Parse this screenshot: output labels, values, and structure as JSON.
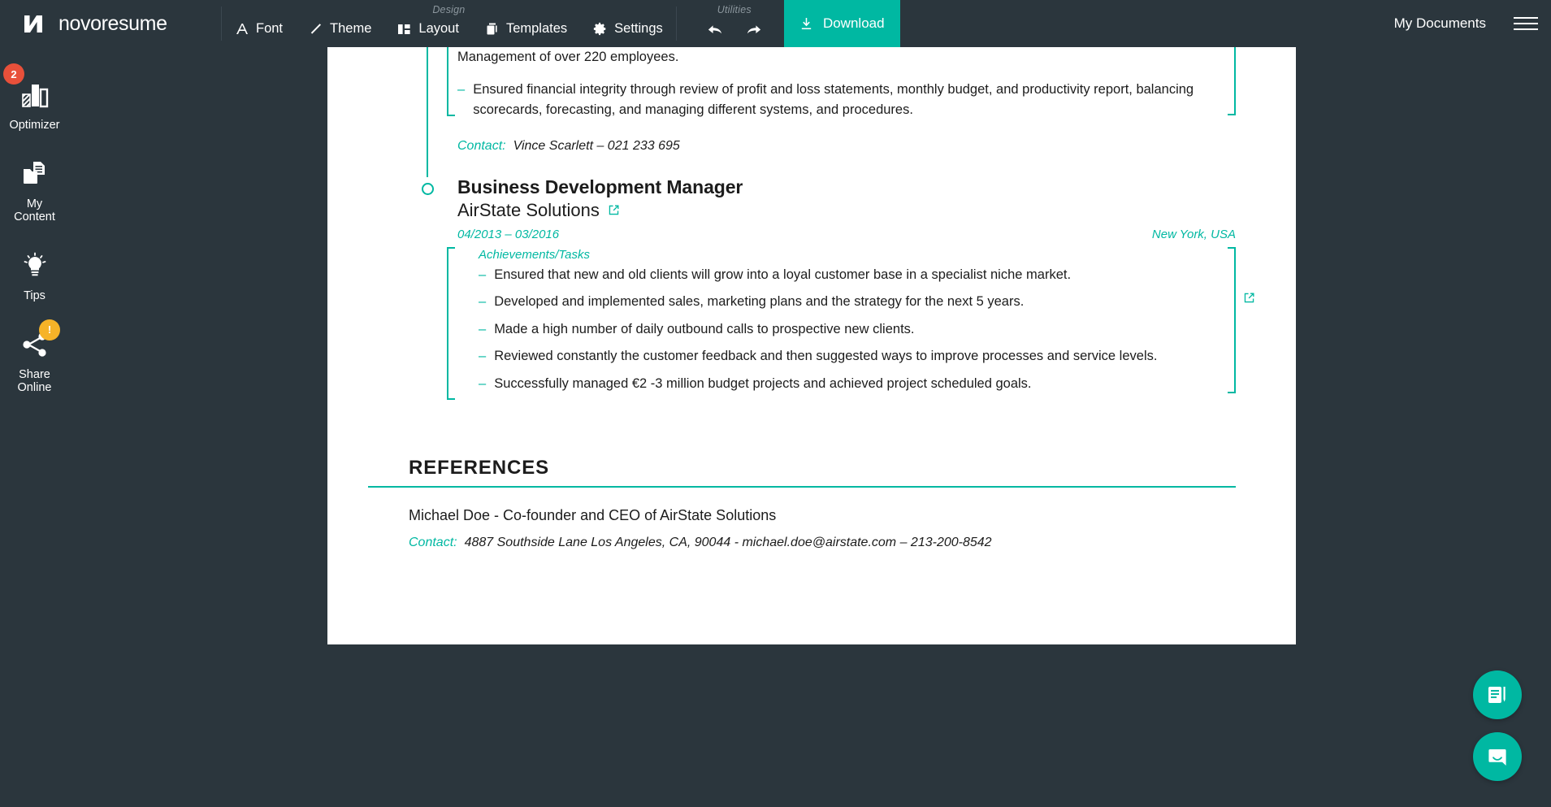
{
  "app": {
    "brand_name": "novoresume",
    "brand_icon": "novoresume-n-logo"
  },
  "toolbar": {
    "design_group_label": "Design",
    "utilities_group_label": "Utilities",
    "items": [
      {
        "label": "Font",
        "icon": "font-a-icon"
      },
      {
        "label": "Theme",
        "icon": "brush-slash-icon"
      },
      {
        "label": "Layout",
        "icon": "layout-columns-icon"
      },
      {
        "label": "Templates",
        "icon": "copy-pages-icon"
      },
      {
        "label": "Settings",
        "icon": "gear-icon"
      }
    ],
    "undo_icon": "undo-arrow-icon",
    "redo_icon": "redo-arrow-icon",
    "download_label": "Download",
    "download_icon": "download-icon",
    "my_documents_label": "My Documents",
    "menu_icon": "hamburger-menu-icon"
  },
  "sidebar": {
    "items": [
      {
        "label": "Optimizer",
        "icon": "bar-chart-icon",
        "badge": "2",
        "badge_color": "#e8503a"
      },
      {
        "label": "My\nContent",
        "label_line1": "My",
        "label_line2": "Content",
        "icon": "folder-document-icon",
        "badge": null
      },
      {
        "label": "Tips",
        "icon": "lightbulb-icon",
        "badge": null
      },
      {
        "label": "Share\nOnline",
        "label_line1": "Share",
        "label_line2": "Online",
        "icon": "share-nodes-icon",
        "badge": "!",
        "badge_color": "#f6b328"
      }
    ]
  },
  "resume": {
    "entry_previous": {
      "partial_bullet_top": "Management of over 220 employees.",
      "bullet_two": "Ensured financial integrity through review of profit and loss statements, monthly budget, and productivity report, balancing scorecards, forecasting, and managing different systems, and procedures.",
      "contact_label": "Contact:",
      "contact_value": "Vince Scarlett – 021 233 695"
    },
    "entry_current": {
      "job_title": "Business Development Manager",
      "company": "AirState Solutions",
      "company_link_icon": "external-link-icon",
      "date_range": "04/2013 – 03/2016",
      "location": "New York, USA",
      "achievements_label": "Achievements/Tasks",
      "bullets": [
        {
          "text": "Ensured that new and old clients will grow into a loyal customer base in a specialist niche market.",
          "has_link": false
        },
        {
          "text": "Developed and implemented sales, marketing plans and the strategy for the next 5 years.",
          "has_link": true
        },
        {
          "text": "Made a high number of daily outbound calls to prospective new clients.",
          "has_link": false
        },
        {
          "text": "Reviewed constantly the customer feedback and then suggested ways to improve processes and service levels.",
          "has_link": false
        },
        {
          "text": "Successfully managed €2 -3 million budget projects and achieved project scheduled goals.",
          "has_link": false
        }
      ]
    },
    "references": {
      "section_title": "REFERENCES",
      "name_line": "Michael Doe - Co-founder and CEO of AirState Solutions",
      "contact_label": "Contact:",
      "contact_value": "4887 Southside Lane Los Angeles, CA, 90044 - michael.doe@airstate.com – 213-200-8542"
    }
  },
  "fabs": [
    {
      "name": "cover-letter-fab",
      "icon": "document-pencil-icon"
    },
    {
      "name": "support-chat-fab",
      "icon": "chat-smile-icon"
    }
  ],
  "colors": {
    "accent": "#00b8a2",
    "chrome": "#2b363d",
    "badge_red": "#e8503a",
    "badge_orange": "#f6b328",
    "page": "#ffffff"
  }
}
